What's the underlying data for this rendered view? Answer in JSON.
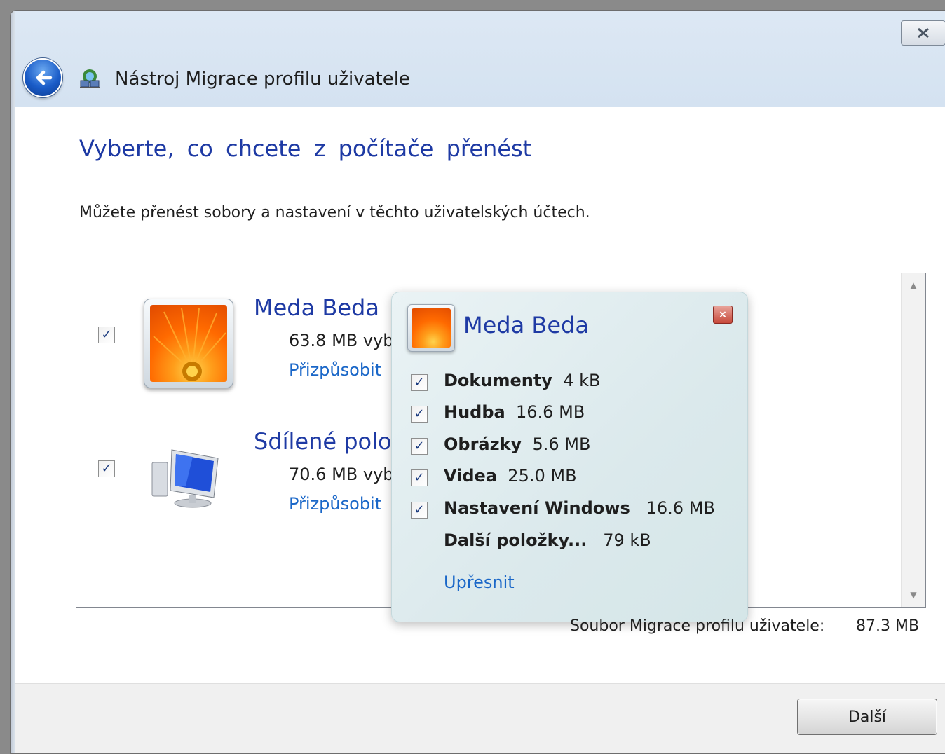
{
  "window": {
    "title": "Nástroj Migrace profilu uživatele"
  },
  "page": {
    "heading": "Vyberte, co chcete z počítače přenést",
    "subtext": "Můžete přenést sobory a nastavení v těchto uživatelských účtech."
  },
  "accounts": [
    {
      "name": "Meda Beda",
      "size": "63.8 MB vyb",
      "link": "Přizpůsobit",
      "checked": true,
      "icon": "flower-user-icon"
    },
    {
      "name": "Sdílené polož",
      "size": "70.6 MB vyb",
      "link": "Přizpůsobit",
      "checked": true,
      "icon": "computer-icon"
    }
  ],
  "popup": {
    "title": "Meda Beda",
    "items": [
      {
        "label": "Dokumenty",
        "size": "4 kB",
        "checked": true
      },
      {
        "label": "Hudba",
        "size": "16.6 MB",
        "checked": true
      },
      {
        "label": "Obrázky",
        "size": "5.6 MB",
        "checked": true
      },
      {
        "label": "Videa",
        "size": "25.0 MB",
        "checked": true
      },
      {
        "label": "Nastavení Windows",
        "size": "16.6 MB",
        "checked": true
      },
      {
        "label": "Další položky...",
        "size": "79 kB"
      }
    ],
    "link": "Upřesnit"
  },
  "footer": {
    "file_label": "Soubor Migrace profilu uživatele:",
    "file_size": "87.3 MB",
    "next_label": "Další"
  },
  "colors": {
    "heading": "#1e3aa4",
    "link": "#1a67c8",
    "header_bg": "#d4e2f1"
  }
}
